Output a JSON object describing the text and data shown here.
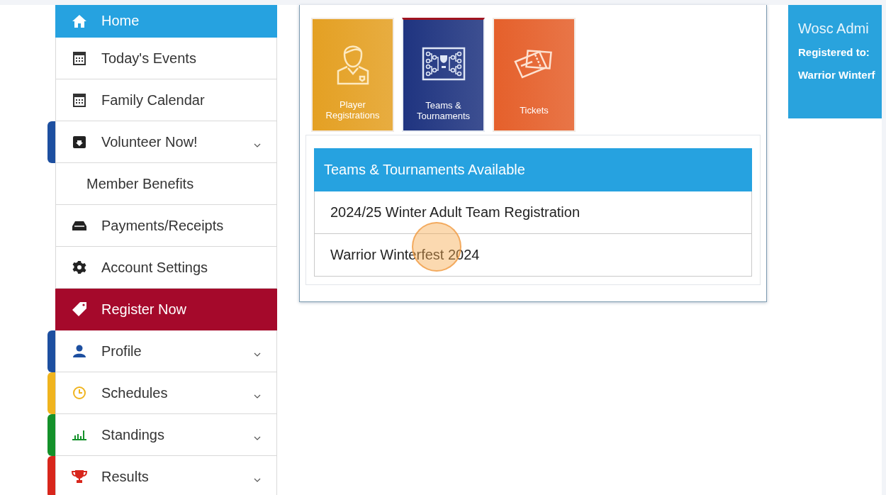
{
  "sidebar": {
    "items": [
      {
        "label": "Home",
        "kind": "active",
        "expandable": false
      },
      {
        "label": "Today's Events",
        "kind": "plain",
        "expandable": false
      },
      {
        "label": "Family Calendar",
        "kind": "plain",
        "expandable": false
      },
      {
        "label": "Volunteer Now!",
        "kind": "plain",
        "expandable": true,
        "color": "#1d4fa0"
      },
      {
        "label": "Member Benefits",
        "kind": "sub",
        "expandable": false
      },
      {
        "label": "Payments/Receipts",
        "kind": "plain",
        "expandable": false
      },
      {
        "label": "Account Settings",
        "kind": "plain",
        "expandable": false
      },
      {
        "label": "Register Now",
        "kind": "highlight",
        "expandable": false
      },
      {
        "label": "Profile",
        "kind": "plain",
        "expandable": true,
        "color": "#1d4fa0"
      },
      {
        "label": "Schedules",
        "kind": "plain",
        "expandable": true,
        "color": "#f0b41e"
      },
      {
        "label": "Standings",
        "kind": "plain",
        "expandable": true,
        "color": "#14912a"
      },
      {
        "label": "Results",
        "kind": "plain",
        "expandable": true,
        "color": "#d8261c"
      }
    ]
  },
  "tiles": [
    {
      "label": "Player Registrations",
      "color": "#e4a023",
      "selected": false
    },
    {
      "label": "Teams & Tournaments",
      "color": "#1f3480",
      "selected": true
    },
    {
      "label": "Tickets",
      "color": "#e5602b",
      "selected": false
    }
  ],
  "list": {
    "title": "Teams & Tournaments Available",
    "items": [
      "2024/25 Winter Adult Team Registration",
      "Warrior Winterfest 2024"
    ]
  },
  "info_card": {
    "title": "Wosc Admi",
    "label": "Registered to:",
    "value": "Warrior Winterf"
  }
}
